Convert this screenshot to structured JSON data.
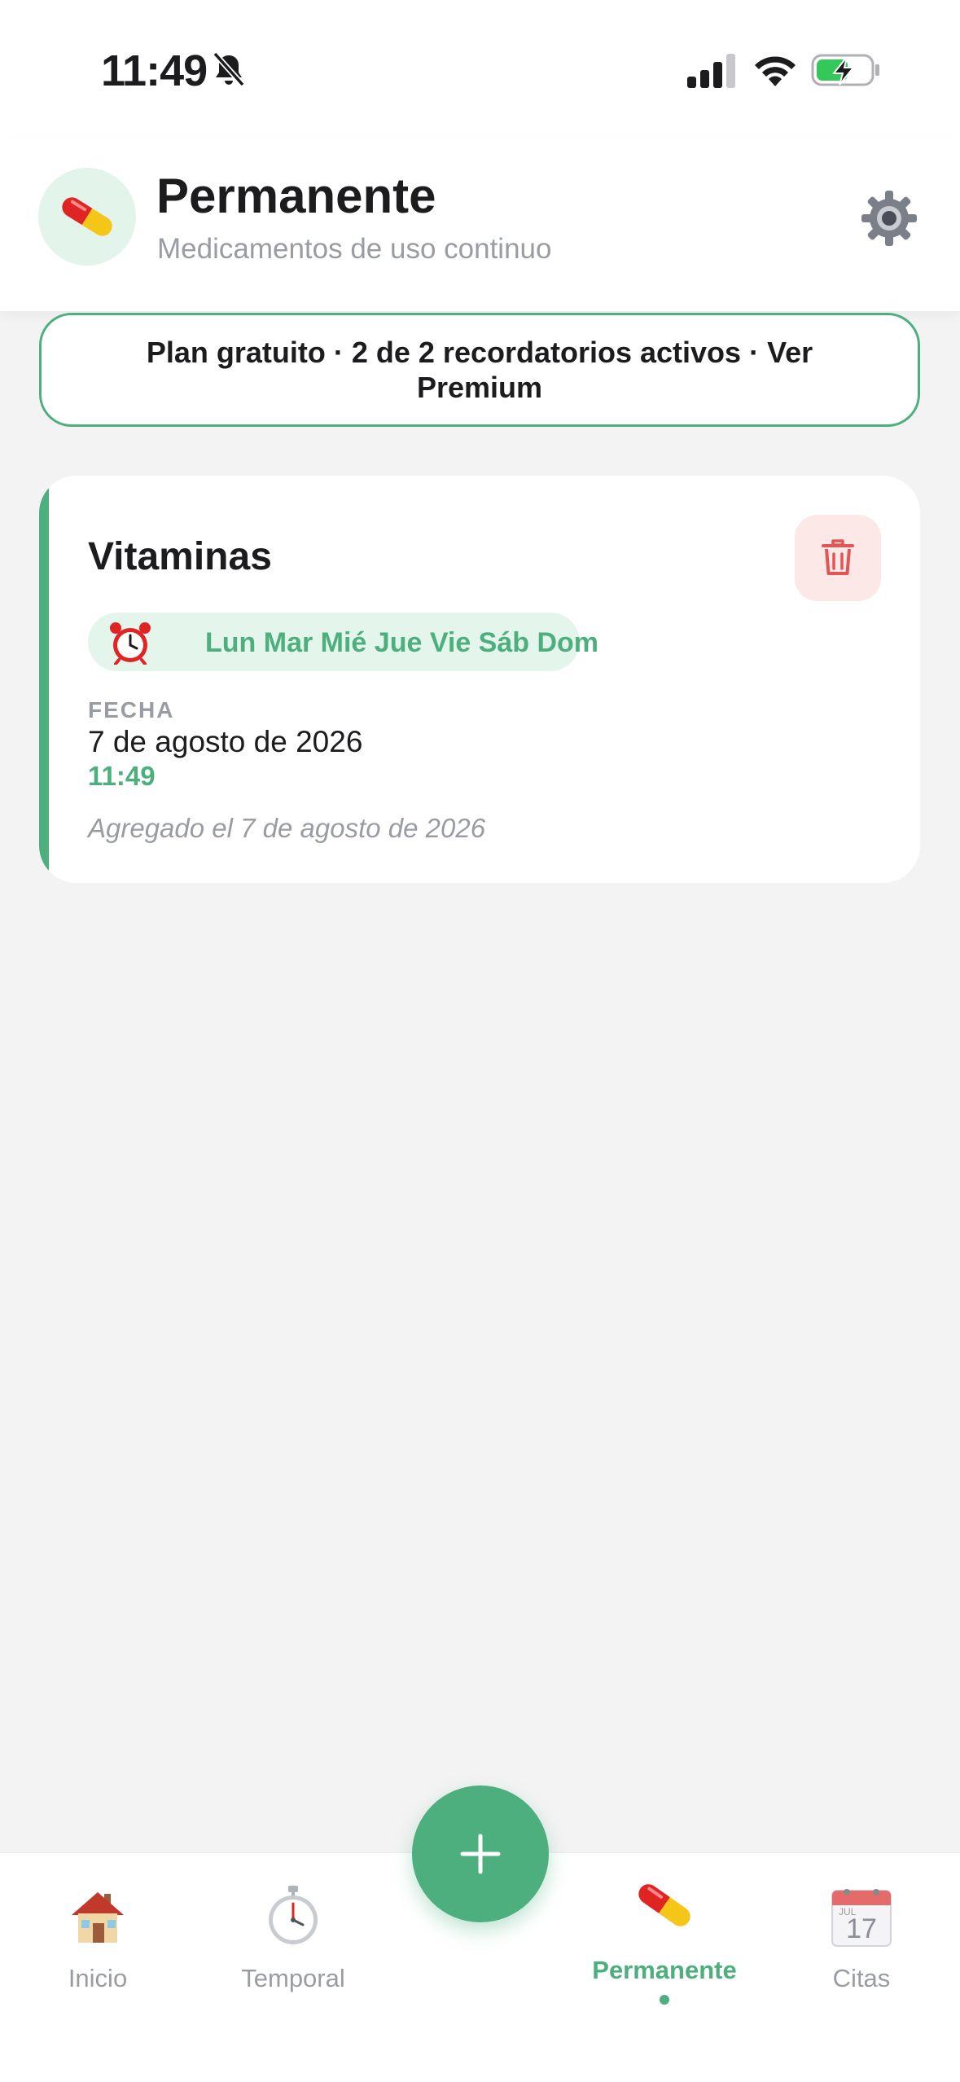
{
  "status_bar": {
    "time": "11:49",
    "icons": [
      "bell-slash-icon",
      "cellular-signal-icon",
      "wifi-icon",
      "battery-charging-icon"
    ]
  },
  "header": {
    "title": "Permanente",
    "subtitle": "Medicamentos de uso continuo",
    "avatar_icon": "pill-icon",
    "settings_icon": "gear-icon"
  },
  "plan_banner": {
    "text": "Plan gratuito · 2 de 2 recordatorios activos · Ver Premium"
  },
  "medications": [
    {
      "name": "Vitaminas",
      "schedule_icon": "alarm-clock-icon",
      "days": "Lun Mar Mié Jue Vie Sáb Dom",
      "date_label": "FECHA",
      "date": "7 de agosto de 2026",
      "time": "11:49",
      "added": "Agregado el 7 de agosto de 2026",
      "delete_icon": "trash-icon"
    }
  ],
  "tab_bar": {
    "tabs": [
      {
        "label": "Inicio",
        "icon": "house-icon",
        "active": false
      },
      {
        "label": "Temporal",
        "icon": "stopwatch-icon",
        "active": false
      },
      {
        "label": "Permanente",
        "icon": "pill-icon",
        "active": true
      },
      {
        "label": "Citas",
        "icon": "calendar-icon",
        "active": false
      }
    ],
    "calendar_icon_text": {
      "month": "JUL",
      "day": "17"
    },
    "fab_icon": "plus-icon"
  },
  "colors": {
    "accent": "#4caf7d",
    "accent_light": "#e4f5ec",
    "danger": "#e05555",
    "danger_light": "#fde8e8",
    "muted_text": "#9a9ca4",
    "background": "#f3f3f3"
  }
}
